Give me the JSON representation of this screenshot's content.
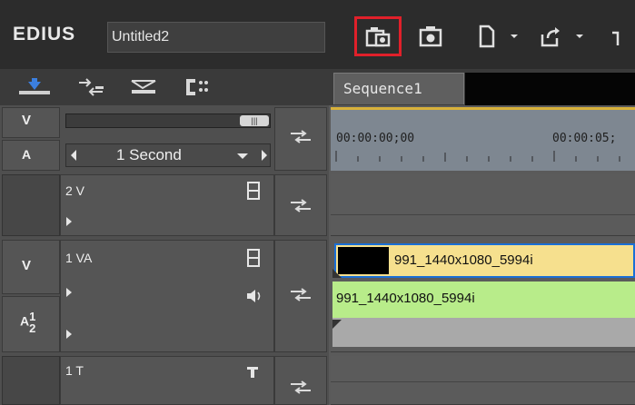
{
  "app": {
    "logo": "EDIUS",
    "project_name": "Untitled2"
  },
  "toolbar": {
    "capture_icon": "capture-icon",
    "snapshot_icon": "snapshot-icon",
    "new_icon": "new-document-icon",
    "export_icon": "export-icon",
    "highlight_color": "#e0202a"
  },
  "timeline_tools": [
    "mode-icon",
    "ripple-icon",
    "waveform-icon",
    "sync-icon"
  ],
  "sequence": {
    "tab_label": "Sequence1"
  },
  "ruler": {
    "timecode_start": "00:00:00;00",
    "timecode_next": "00:00:05;"
  },
  "scale": {
    "label": "1 Second",
    "v_btn": "V",
    "a_btn": "A"
  },
  "tracks": [
    {
      "name": "2 V"
    },
    {
      "name": "1 VA",
      "audio_label_main": "A",
      "audio_label_sup": "1",
      "audio_label_sub": "2"
    },
    {
      "name": "1 T"
    }
  ],
  "clips": {
    "video": "991_1440x1080_5994i",
    "audio": "991_1440x1080_5994i"
  }
}
